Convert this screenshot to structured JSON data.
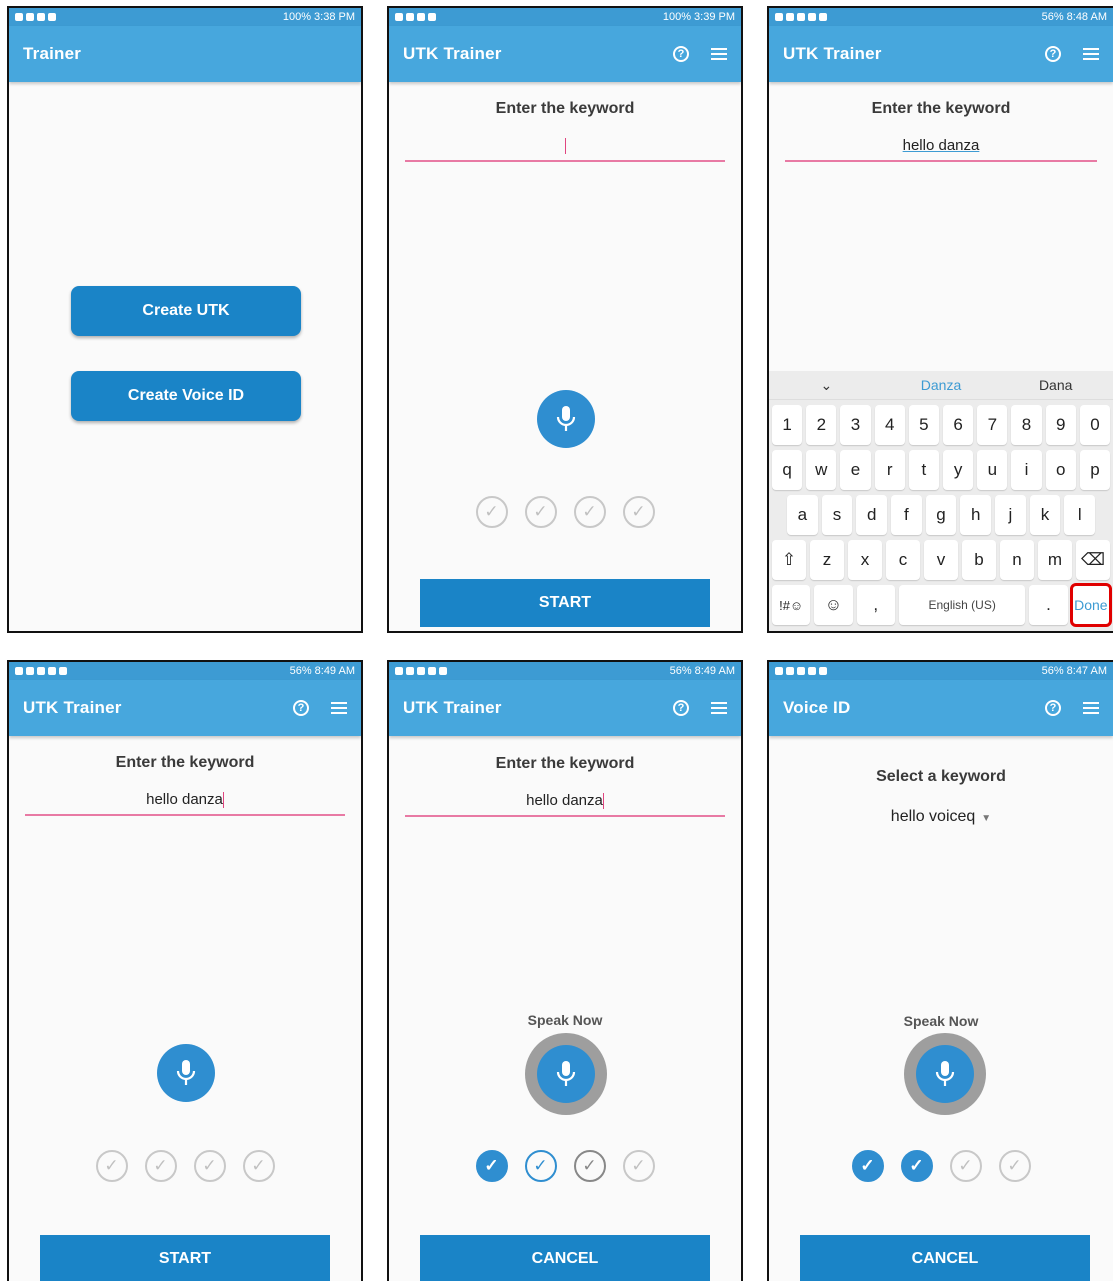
{
  "screens": [
    {
      "status": {
        "battery": "100%",
        "time": "3:38 PM"
      },
      "title": "Trainer",
      "buttons": [
        "Create UTK",
        "Create Voice ID"
      ]
    },
    {
      "status": {
        "battery": "100%",
        "time": "3:39 PM"
      },
      "title": "UTK Trainer",
      "heading": "Enter the keyword",
      "input_value": "",
      "checks": [
        "pending",
        "pending",
        "pending",
        "pending"
      ],
      "button": "START"
    },
    {
      "status": {
        "battery": "56%",
        "time": "8:48 AM"
      },
      "title": "UTK Trainer",
      "heading": "Enter the keyword",
      "input_value": "hello danza",
      "keyboard": {
        "suggestions": [
          "Danza",
          "Dana"
        ],
        "row1": [
          "1",
          "2",
          "3",
          "4",
          "5",
          "6",
          "7",
          "8",
          "9",
          "0"
        ],
        "row2": [
          "q",
          "w",
          "e",
          "r",
          "t",
          "y",
          "u",
          "i",
          "o",
          "p"
        ],
        "row3": [
          "a",
          "s",
          "d",
          "f",
          "g",
          "h",
          "j",
          "k",
          "l"
        ],
        "row4": [
          "z",
          "x",
          "c",
          "v",
          "b",
          "n",
          "m"
        ],
        "symbols_key": "!#☺",
        "comma_key": ",",
        "space_key": "English (US)",
        "period_key": ".",
        "done_key": "Done"
      }
    },
    {
      "status": {
        "battery": "56%",
        "time": "8:49 AM"
      },
      "title": "UTK Trainer",
      "heading": "Enter the keyword",
      "input_value": "hello danza",
      "checks": [
        "pending",
        "pending",
        "pending",
        "pending"
      ],
      "button": "START"
    },
    {
      "status": {
        "battery": "56%",
        "time": "8:49 AM"
      },
      "title": "UTK Trainer",
      "heading": "Enter the keyword",
      "input_value": "hello danza",
      "speak": "Speak Now",
      "checks": [
        "done",
        "active",
        "pending",
        "pending"
      ],
      "button": "CANCEL"
    },
    {
      "status": {
        "battery": "56%",
        "time": "8:47 AM"
      },
      "title": "Voice ID",
      "heading": "Select a keyword",
      "dropdown_value": "hello voiceq",
      "speak": "Speak Now",
      "checks": [
        "done",
        "done",
        "pending",
        "pending"
      ],
      "button": "CANCEL"
    }
  ],
  "icons": {
    "help": "help-circle-icon",
    "menu": "list-menu-icon",
    "mic": "microphone-icon",
    "check": "check-circle-icon"
  },
  "colors": {
    "appbar": "#47a7dd",
    "button": "#1a84c7",
    "input_underline": "#e87aa4",
    "highlight": "#e00000"
  }
}
